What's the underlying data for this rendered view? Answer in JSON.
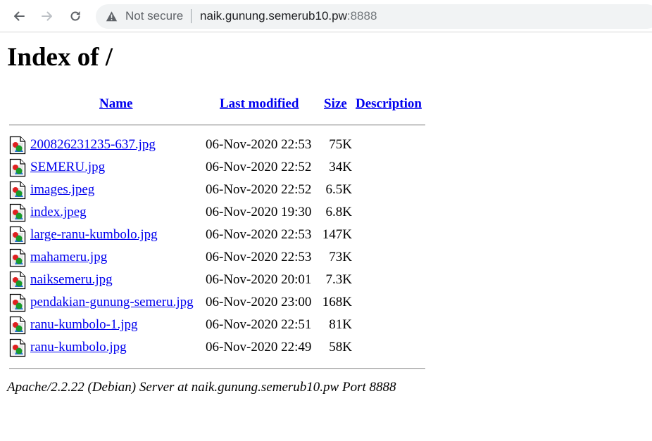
{
  "browser": {
    "security_label": "Not secure",
    "url_host": "naik.gunung.semerub10.pw",
    "url_port": ":8888"
  },
  "page": {
    "title": "Index of /",
    "columns": {
      "name": "Name",
      "last_modified": "Last modified",
      "size": "Size",
      "description": "Description"
    },
    "files": [
      {
        "name": "200826231235-637.jpg",
        "modified": "06-Nov-2020 22:53",
        "size": "75K"
      },
      {
        "name": "SEMERU.jpg",
        "modified": "06-Nov-2020 22:52",
        "size": "34K"
      },
      {
        "name": "images.jpeg",
        "modified": "06-Nov-2020 22:52",
        "size": "6.5K"
      },
      {
        "name": "index.jpeg",
        "modified": "06-Nov-2020 19:30",
        "size": "6.8K"
      },
      {
        "name": "large-ranu-kumbolo.jpg",
        "modified": "06-Nov-2020 22:53",
        "size": "147K"
      },
      {
        "name": "mahameru.jpg",
        "modified": "06-Nov-2020 22:53",
        "size": "73K"
      },
      {
        "name": "naiksemeru.jpg",
        "modified": "06-Nov-2020 20:01",
        "size": "7.3K"
      },
      {
        "name": "pendakian-gunung-semeru.jpg",
        "modified": "06-Nov-2020 23:00",
        "size": "168K"
      },
      {
        "name": "ranu-kumbolo-1.jpg",
        "modified": "06-Nov-2020 22:51",
        "size": "81K"
      },
      {
        "name": "ranu-kumbolo.jpg",
        "modified": "06-Nov-2020 22:49",
        "size": "58K"
      }
    ],
    "server_signature": "Apache/2.2.22 (Debian) Server at naik.gunung.semerub10.pw Port 8888"
  },
  "icons": {
    "back": "arrow-left-icon",
    "forward": "arrow-right-icon",
    "reload": "reload-icon",
    "security": "warning-triangle-icon",
    "file": "image-file-icon"
  },
  "colors": {
    "link": "#0000ee",
    "omnibox_bg": "#f1f3f4"
  }
}
